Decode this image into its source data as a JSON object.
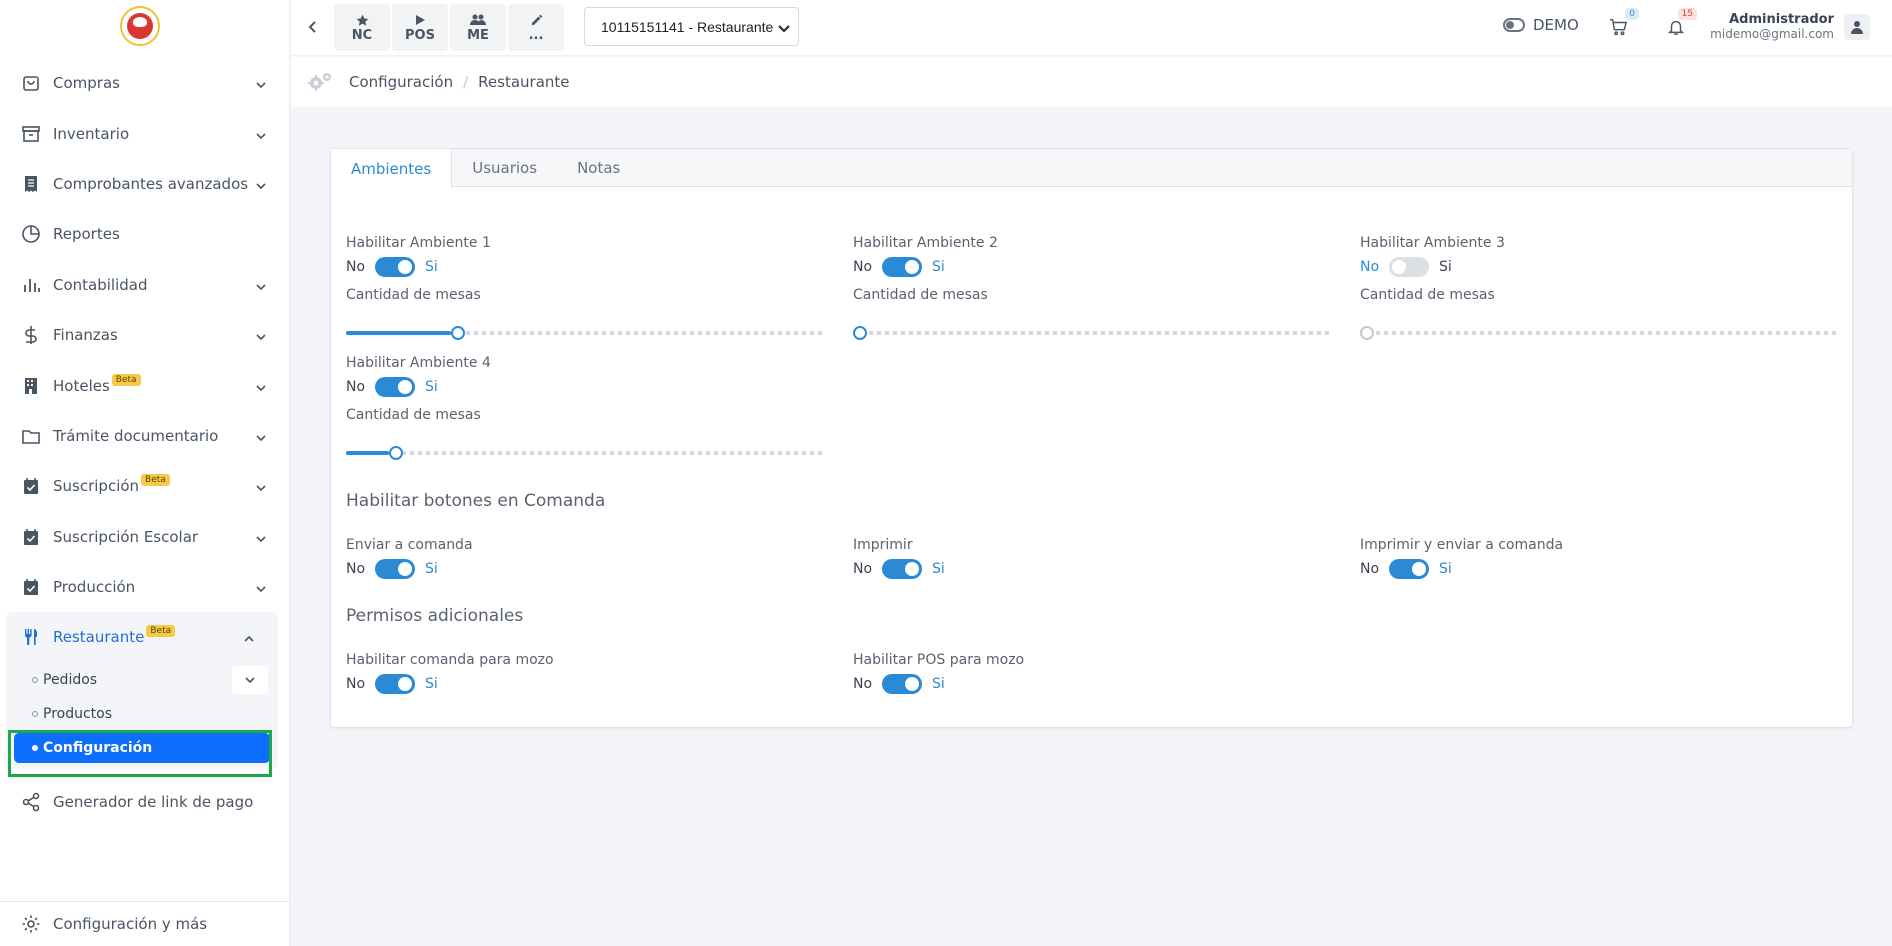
{
  "sidebar": {
    "items": [
      {
        "label": "Compras",
        "icon": "bag-icon",
        "has_chevron": true
      },
      {
        "label": "Inventario",
        "icon": "archive-icon",
        "has_chevron": true
      },
      {
        "label": "Comprobantes avanzados",
        "icon": "receipt-icon",
        "has_chevron": true
      },
      {
        "label": "Reportes",
        "icon": "pie-chart-icon",
        "has_chevron": false
      },
      {
        "label": "Contabilidad",
        "icon": "bar-chart-icon",
        "has_chevron": true
      },
      {
        "label": "Finanzas",
        "icon": "dollar-icon",
        "has_chevron": true
      },
      {
        "label": "Hoteles",
        "badge": "Beta",
        "icon": "building-icon",
        "has_chevron": true
      },
      {
        "label": "Trámite documentario",
        "icon": "folder-icon",
        "has_chevron": true
      },
      {
        "label": "Suscripción",
        "badge": "Beta",
        "icon": "calendar-check-icon",
        "has_chevron": true
      },
      {
        "label": "Suscripción Escolar",
        "icon": "calendar-check-icon",
        "has_chevron": true
      },
      {
        "label": "Producción",
        "icon": "calendar-check-icon",
        "has_chevron": true
      }
    ],
    "restaurante": {
      "label": "Restaurante",
      "badge": "Beta"
    },
    "restaurante_sub": [
      {
        "label": "Pedidos"
      },
      {
        "label": "Productos"
      },
      {
        "label": "Configuración"
      }
    ],
    "link_pago": "Generador de link de pago",
    "footer": "Configuración y más"
  },
  "topbar": {
    "quick": [
      {
        "label": "NC",
        "icon": "star-icon"
      },
      {
        "label": "POS",
        "icon": "play-icon"
      },
      {
        "label": "ME",
        "icon": "users-icon"
      },
      {
        "label": "...",
        "icon": "pencil-icon"
      }
    ],
    "company": "10115151141 - Restaurante",
    "demo": "DEMO",
    "cart_count": "0",
    "notif_count": "15",
    "user_name": "Administrador",
    "user_email": "midemo@gmail.com"
  },
  "breadcrumb": [
    "Configuración",
    "Restaurante"
  ],
  "tabs": [
    "Ambientes",
    "Usuarios",
    "Notas"
  ],
  "toggle_labels": {
    "no": "No",
    "si": "Si"
  },
  "ambientes": [
    {
      "label": "Habilitar Ambiente 1",
      "enabled": true,
      "mesas_label": "Cantidad de mesas",
      "mesas_fraction": 0.22
    },
    {
      "label": "Habilitar Ambiente 2",
      "enabled": true,
      "mesas_label": "Cantidad de mesas",
      "mesas_fraction": 0.0
    },
    {
      "label": "Habilitar Ambiente 3",
      "enabled": false,
      "mesas_label": "Cantidad de mesas",
      "mesas_fraction": 0.0
    },
    {
      "label": "Habilitar Ambiente 4",
      "enabled": true,
      "mesas_label": "Cantidad de mesas",
      "mesas_fraction": 0.09
    }
  ],
  "comanda": {
    "title": "Habilitar botones en Comanda",
    "items": [
      {
        "label": "Enviar a comanda",
        "enabled": true
      },
      {
        "label": "Imprimir",
        "enabled": true
      },
      {
        "label": "Imprimir y enviar a comanda",
        "enabled": true
      }
    ]
  },
  "permisos": {
    "title": "Permisos adicionales",
    "items": [
      {
        "label": "Habilitar comanda para mozo",
        "enabled": true
      },
      {
        "label": "Habilitar POS para mozo",
        "enabled": true
      }
    ]
  },
  "colors": {
    "accent": "#2b8ad6",
    "active_item": "#0d6efd",
    "focus_frame": "#1fa84a",
    "beta_badge": "#f7c948"
  }
}
